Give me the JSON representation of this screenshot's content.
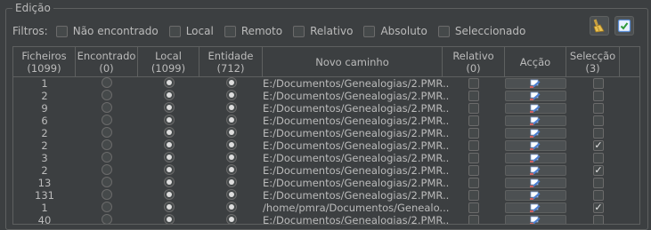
{
  "group_title": "Edição",
  "filters": {
    "label": "Filtros:",
    "items": [
      {
        "label": "Não encontrado",
        "checked": false
      },
      {
        "label": "Local",
        "checked": false
      },
      {
        "label": "Remoto",
        "checked": false
      },
      {
        "label": "Relativo",
        "checked": false
      },
      {
        "label": "Absoluto",
        "checked": false
      },
      {
        "label": "Seleccionado",
        "checked": false
      }
    ]
  },
  "toolbar": {
    "clean_icon": "broom-icon",
    "apply_icon": "apply-check-icon"
  },
  "columns": [
    {
      "label": "Ficheiros",
      "count": "(1099)"
    },
    {
      "label": "Encontrado",
      "count": "(0)"
    },
    {
      "label": "Local",
      "count": "(1099)"
    },
    {
      "label": "Entidade",
      "count": "(712)"
    },
    {
      "label": "Novo caminho",
      "count": ""
    },
    {
      "label": "Relativo",
      "count": "(0)"
    },
    {
      "label": "Acção",
      "count": ""
    },
    {
      "label": "Selecção",
      "count": "(3)"
    }
  ],
  "action_icon": "edit-path-icon",
  "rows": [
    {
      "files": "1",
      "found": false,
      "local": true,
      "entity": true,
      "path": "E:/Documentos/Genealogias/2.PMR...",
      "relative": false,
      "selected": false
    },
    {
      "files": "2",
      "found": false,
      "local": true,
      "entity": true,
      "path": "E:/Documentos/Genealogias/2.PMR...",
      "relative": false,
      "selected": false
    },
    {
      "files": "9",
      "found": false,
      "local": true,
      "entity": true,
      "path": "E:/Documentos/Genealogias/2.PMR...",
      "relative": false,
      "selected": false
    },
    {
      "files": "6",
      "found": false,
      "local": true,
      "entity": true,
      "path": "E:/Documentos/Genealogias/2.PMR...",
      "relative": false,
      "selected": false
    },
    {
      "files": "2",
      "found": false,
      "local": true,
      "entity": true,
      "path": "E:/Documentos/Genealogias/2.PMR...",
      "relative": false,
      "selected": false
    },
    {
      "files": "2",
      "found": false,
      "local": true,
      "entity": true,
      "path": "E:/Documentos/Genealogias/2.PMR...",
      "relative": false,
      "selected": true
    },
    {
      "files": "3",
      "found": false,
      "local": true,
      "entity": true,
      "path": "E:/Documentos/Genealogias/2.PMR...",
      "relative": false,
      "selected": false
    },
    {
      "files": "2",
      "found": false,
      "local": true,
      "entity": true,
      "path": "E:/Documentos/Genealogias/2.PMR...",
      "relative": false,
      "selected": true
    },
    {
      "files": "13",
      "found": false,
      "local": true,
      "entity": true,
      "path": "E:/Documentos/Genealogias/2.PMR...",
      "relative": false,
      "selected": false
    },
    {
      "files": "131",
      "found": false,
      "local": true,
      "entity": true,
      "path": "E:/Documentos/Genealogias/2.PMR...",
      "relative": false,
      "selected": false
    },
    {
      "files": "1",
      "found": false,
      "local": true,
      "entity": true,
      "path": "/home/pmra/Documentos/Genealo...",
      "relative": false,
      "selected": true
    },
    {
      "files": "40",
      "found": false,
      "local": true,
      "entity": true,
      "path": "E:/Documentos/Genealogias/2.PMR...",
      "relative": false,
      "selected": false
    }
  ]
}
